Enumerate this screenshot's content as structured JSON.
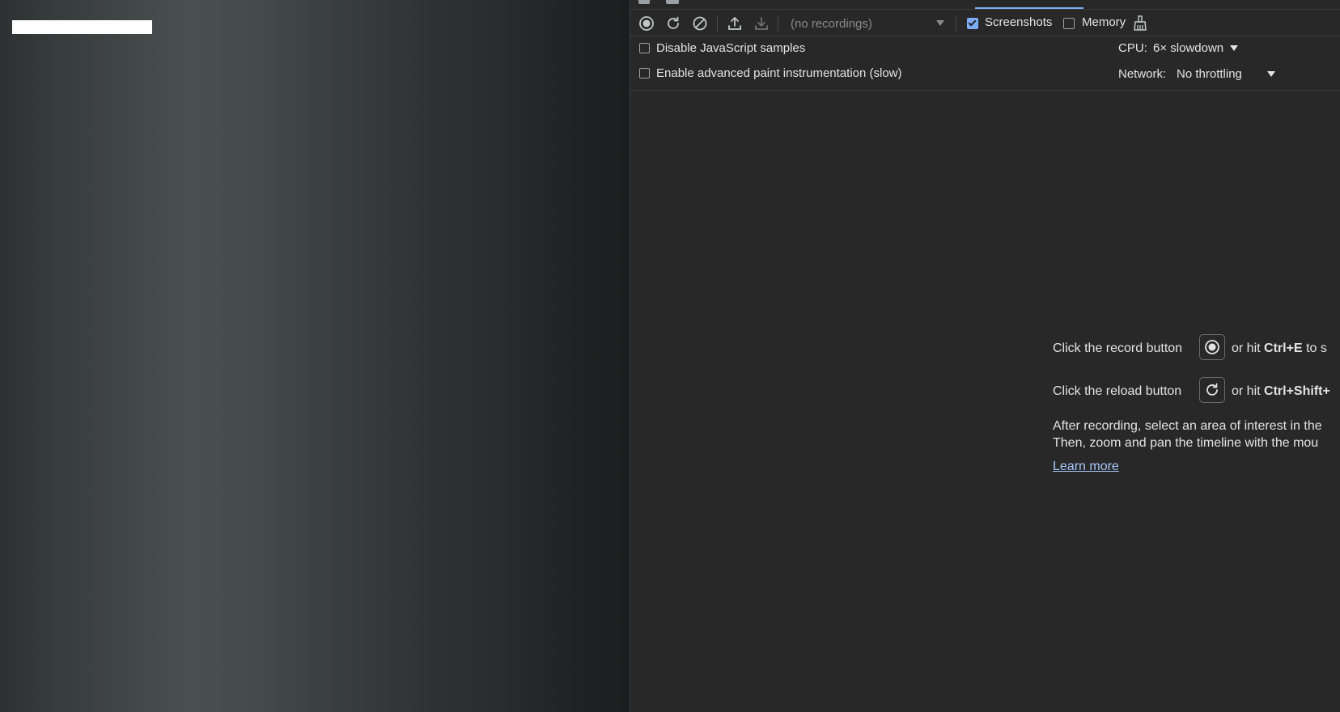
{
  "devtools": {
    "toolbar": {
      "record_icon": "record-icon",
      "reload_icon": "reload-record-icon",
      "clear_icon": "clear-icon",
      "upload_icon": "upload-icon",
      "download_icon": "download-icon",
      "recordings_select": "(no recordings)",
      "screenshots_label": "Screenshots",
      "screenshots_checked": true,
      "memory_label": "Memory",
      "memory_checked": false,
      "gc_icon": "broom-icon"
    },
    "settings": {
      "disable_js_samples": "Disable JavaScript samples",
      "advanced_paint": "Enable advanced paint instrumentation (slow)",
      "cpu_label": "CPU:",
      "cpu_value": "6× slowdown",
      "network_label": "Network:",
      "network_value": "No throttling"
    },
    "landing": {
      "record_line_prefix": "Click the record button",
      "record_line_suffix_pre": "or hit",
      "record_line_shortcut": "Ctrl+E",
      "record_line_suffix_post": "to s",
      "reload_line_prefix": "Click the reload button",
      "reload_line_suffix_pre": "or hit",
      "reload_line_shortcut": "Ctrl+Shift+",
      "after_line_1": "After recording, select an area of interest in the",
      "after_line_2": "Then, zoom and pan the timeline with the mou",
      "learn_more": "Learn more"
    },
    "colors": {
      "accent": "#7cacf8",
      "link": "#a8c7fa",
      "panel_bg": "#282828"
    }
  }
}
